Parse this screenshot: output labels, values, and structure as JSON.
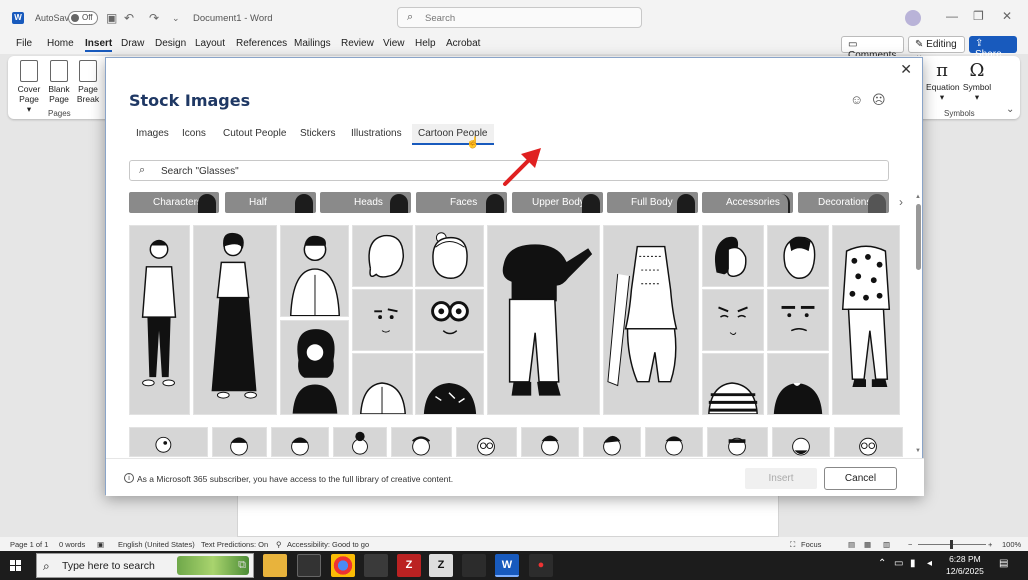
{
  "titlebar": {
    "app_icon": "W",
    "autosave_label": "AutoSave",
    "autosave_state": "Off",
    "doc_title": "Document1 - Word",
    "search_placeholder": "Search"
  },
  "menu": {
    "items": [
      "File",
      "Home",
      "Insert",
      "Draw",
      "Design",
      "Layout",
      "References",
      "Mailings",
      "Review",
      "View",
      "Help",
      "Acrobat"
    ],
    "active": "Insert",
    "comments_label": "Comments",
    "editing_label": "Editing",
    "share_label": "Share"
  },
  "ribbon": {
    "pages_group": {
      "label": "Pages",
      "buttons": [
        {
          "line1": "Cover",
          "line2": "Page ▾"
        },
        {
          "line1": "Blank",
          "line2": "Page"
        },
        {
          "line1": "Page",
          "line2": "Break"
        }
      ]
    },
    "symbols_group": {
      "label": "Symbols",
      "buttons": [
        {
          "line1": "Equation",
          "line2": "▾",
          "glyph": "π"
        },
        {
          "line1": "Symbol",
          "line2": "▾",
          "glyph": "Ω"
        }
      ]
    }
  },
  "dialog": {
    "title": "Stock Images",
    "tabs": [
      "Images",
      "Icons",
      "Cutout People",
      "Stickers",
      "Illustrations",
      "Cartoon People"
    ],
    "active_tab": "Cartoon People",
    "search_value": "Search \"Glasses\"",
    "categories": [
      "Characters",
      "Half Characters",
      "Heads",
      "Faces",
      "Upper Body",
      "Full Body",
      "Accessories",
      "Decorations"
    ],
    "footer_info": "As a Microsoft 365 subscriber, you have access to the full library of creative content.",
    "insert_label": "Insert",
    "cancel_label": "Cancel"
  },
  "statusbar": {
    "page": "Page 1 of 1",
    "words": "0 words",
    "language": "English (United States)",
    "predictions": "Text Predictions: On",
    "accessibility": "Accessibility: Good to go",
    "focus": "Focus",
    "zoom": "100%"
  },
  "taskbar": {
    "search_placeholder": "Type here to search",
    "time": "6:28 PM",
    "date": "12/6/2025"
  },
  "colors": {
    "accent": "#185abd",
    "title_text": "#1f3864",
    "category_bg": "#8a8a8a",
    "annotation_arrow": "#e02020"
  }
}
